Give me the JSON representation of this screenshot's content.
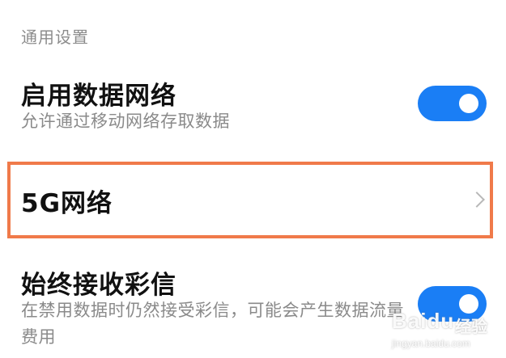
{
  "section": {
    "header": "通用设置"
  },
  "settings": [
    {
      "title": "启用数据网络",
      "subtitle": "允许通过移动网络存取数据",
      "control": "toggle",
      "enabled": true
    },
    {
      "title": "5G网络",
      "control": "chevron-right-icon",
      "highlighted": true
    },
    {
      "title": "始终接收彩信",
      "subtitle": "在禁用数据时仍然接受彩信，可能会产生数据流量费用",
      "control": "toggle",
      "enabled": true
    }
  ],
  "watermark": {
    "brand": "Baidu",
    "label": "经验",
    "url": "jingyan.baidu.com"
  },
  "colors": {
    "accent": "#1a7ef5",
    "highlight_border": "#f07a4a",
    "secondary_text": "#8a8a8a"
  }
}
